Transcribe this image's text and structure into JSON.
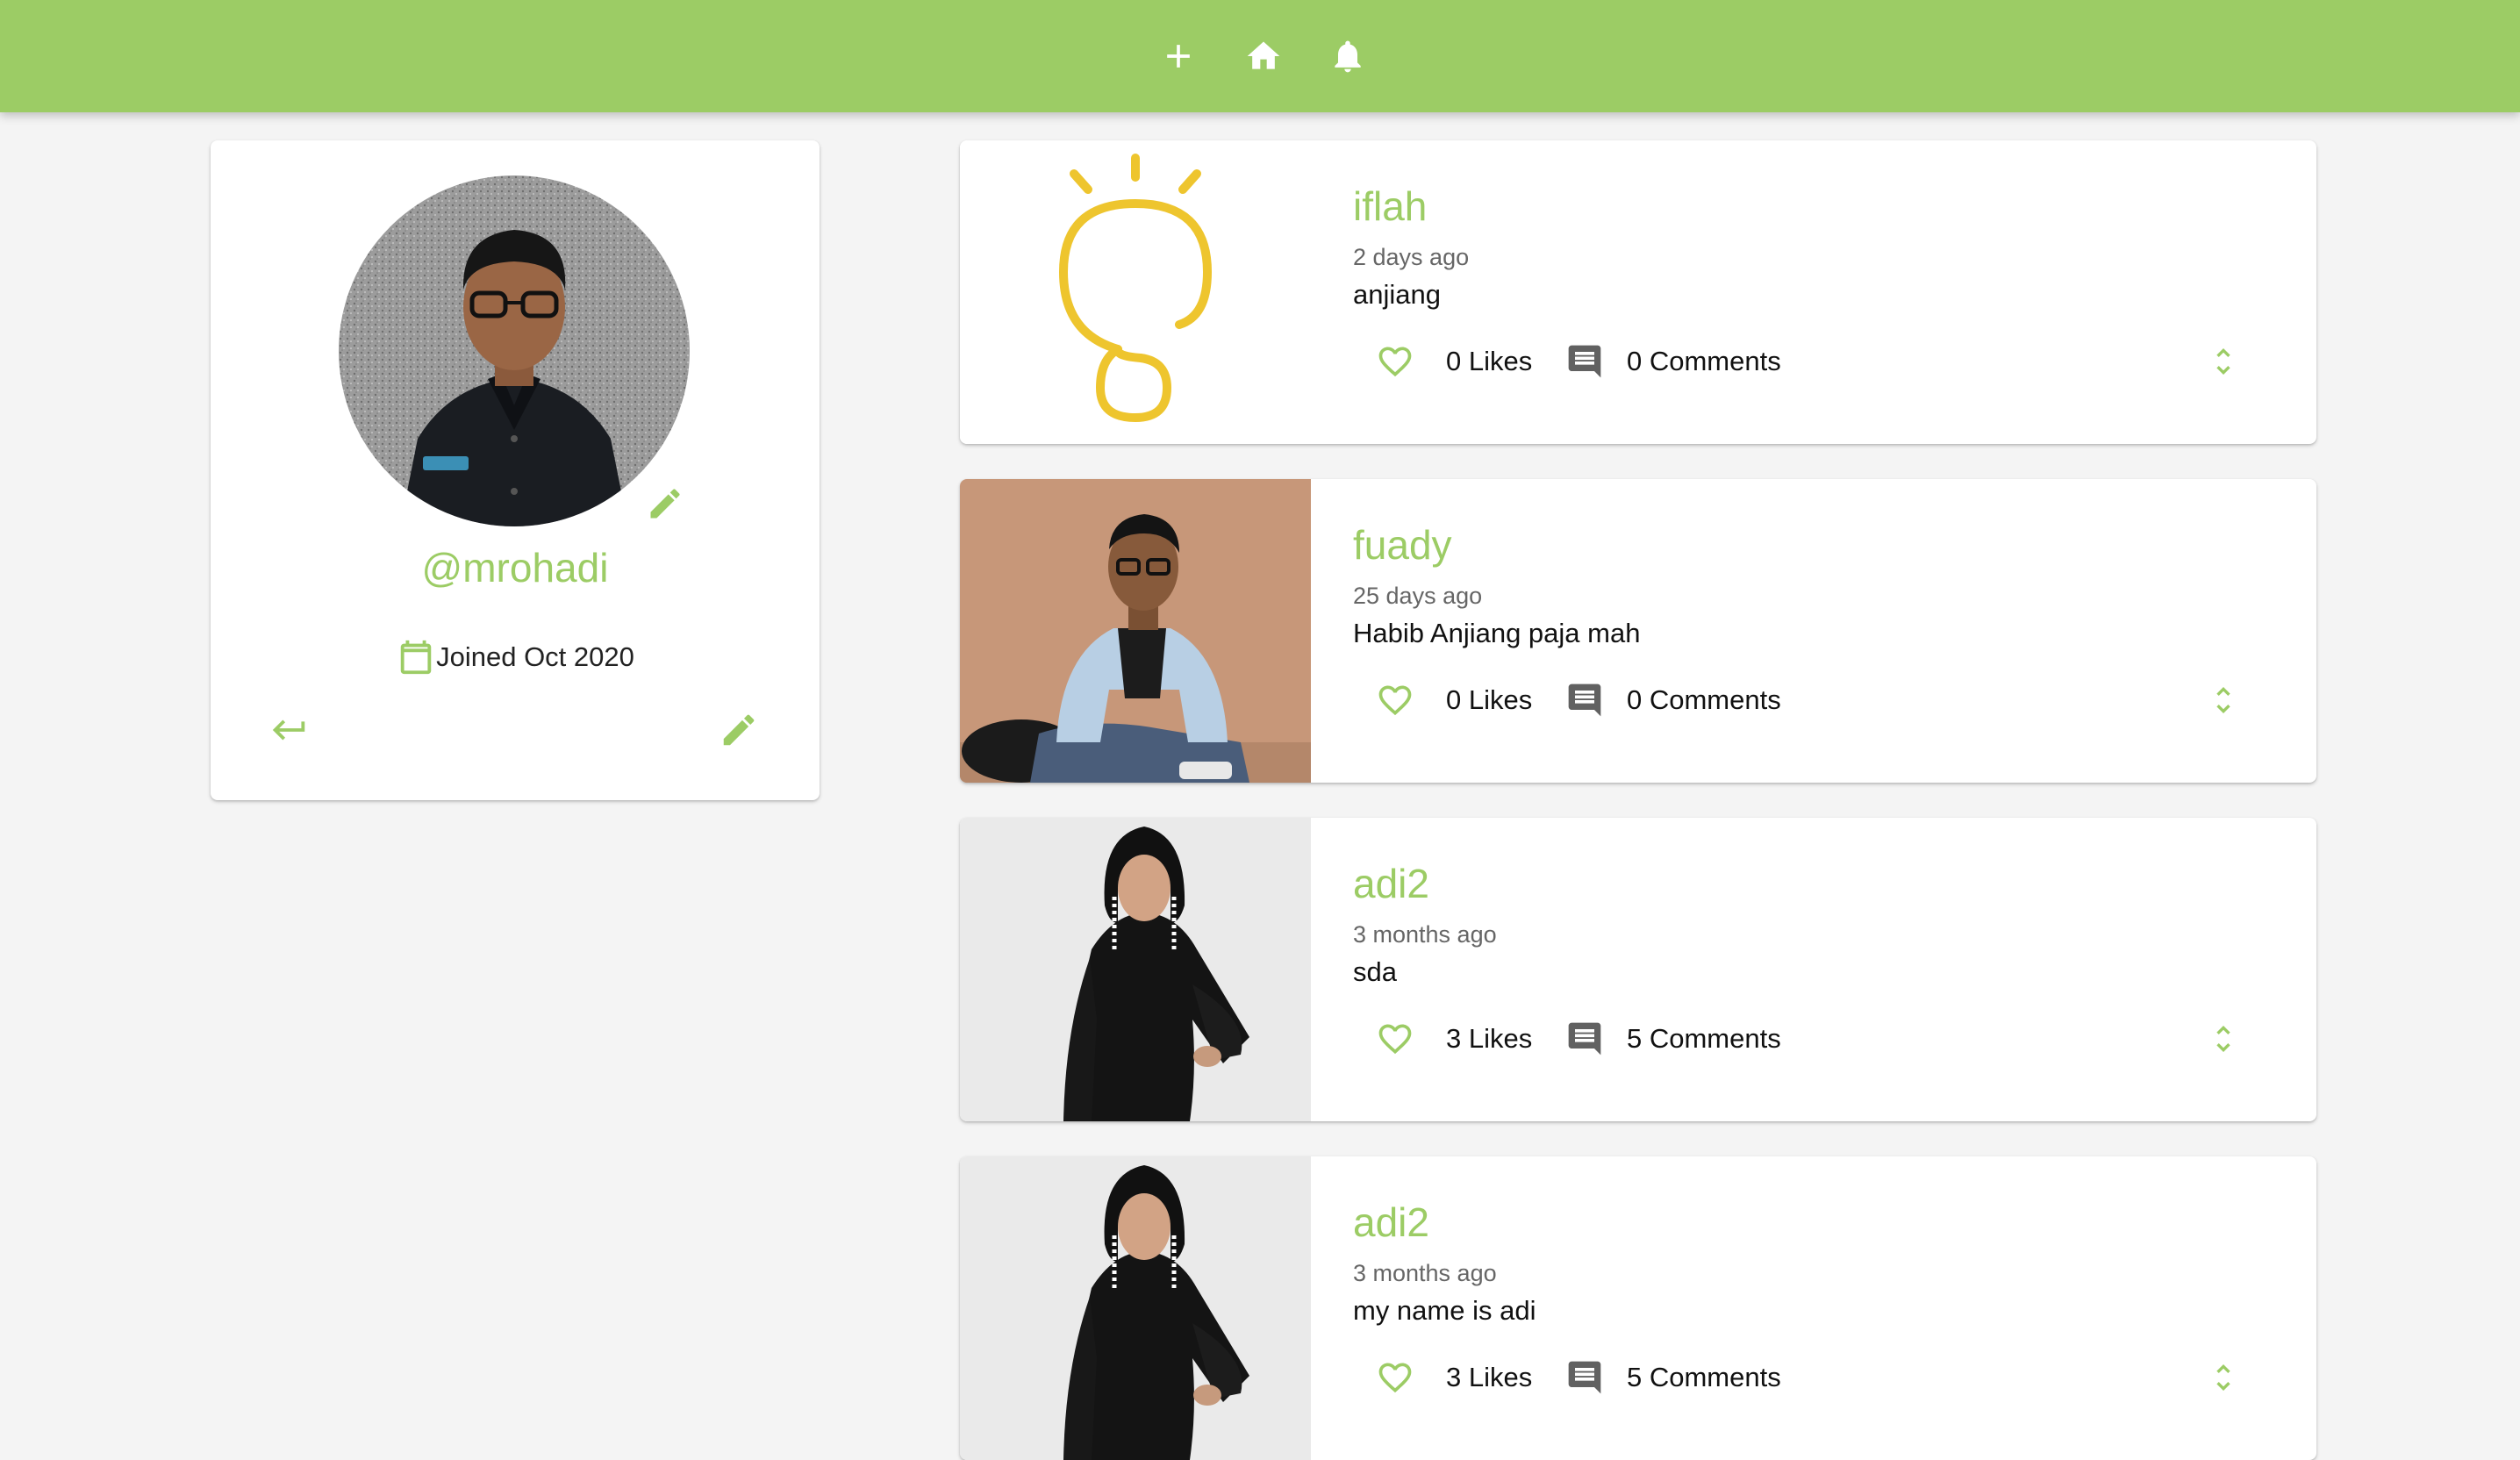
{
  "appbar": {
    "icons": [
      "add-icon",
      "home-icon",
      "notifications-icon"
    ]
  },
  "colors": {
    "brand": "#9ccc65",
    "background": "#f4f4f4",
    "comment_icon": "#616161",
    "bulb_yellow": "#eec52e"
  },
  "profile": {
    "handle": "@mrohadi",
    "joined": "Joined Oct 2020",
    "icons": [
      "avatar-edit-icon",
      "calendar-icon",
      "keyboard-return-icon",
      "edit-icon"
    ]
  },
  "posts": [
    {
      "user": "iflah",
      "time": "2 days ago",
      "body": "anjiang",
      "likes": "0 Likes",
      "comments": "0 Comments",
      "media": "lightbulb-image"
    },
    {
      "user": "fuady",
      "time": "25 days ago",
      "body": "Habib Anjiang paja mah",
      "likes": "0 Likes",
      "comments": "0 Comments",
      "media": "man-denim-jacket-photo"
    },
    {
      "user": "adi2",
      "time": "3 months ago",
      "body": "sda",
      "likes": "3 Likes",
      "comments": "5 Comments",
      "media": "woman-black-dress-photo"
    },
    {
      "user": "adi2",
      "time": "3 months ago",
      "body": "my name is adi",
      "likes": "3 Likes",
      "comments": "5 Comments",
      "media": "woman-black-dress-photo"
    }
  ]
}
